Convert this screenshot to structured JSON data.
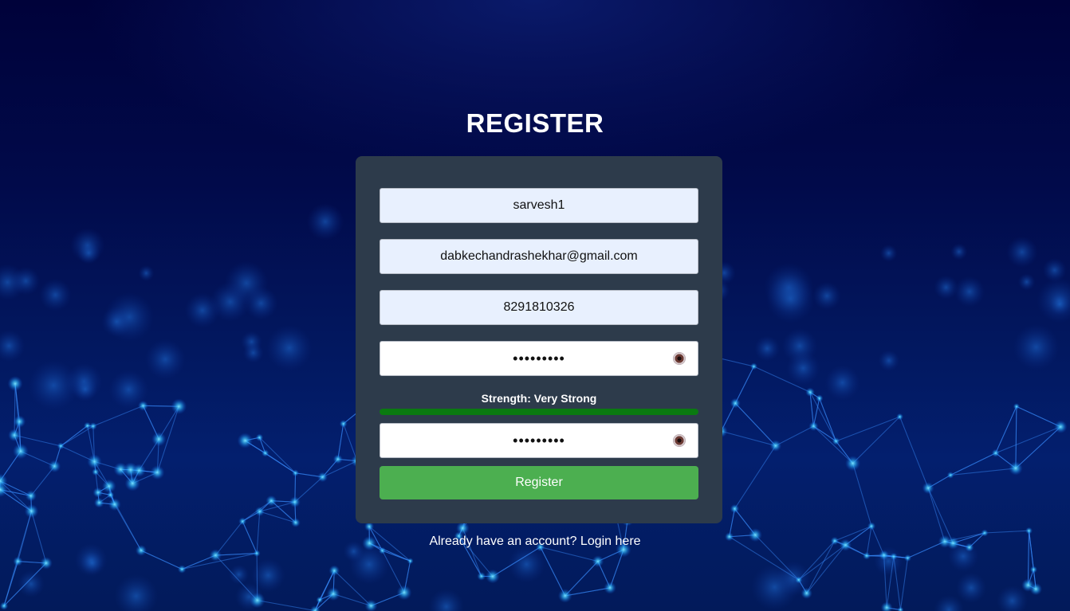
{
  "page": {
    "title": "REGISTER"
  },
  "form": {
    "username": {
      "value": "sarvesh1"
    },
    "email": {
      "value": "dabkechandrashekhar@gmail.com"
    },
    "phone": {
      "value": "8291810326"
    },
    "password": {
      "value": "sarvesh12",
      "toggle_icon": "eye-icon"
    },
    "strength": {
      "label": "Strength: Very Strong",
      "level": 1.0,
      "color": "#0a7a10"
    },
    "confirm_password": {
      "value": "sarvesh12",
      "toggle_icon": "eye-icon"
    },
    "submit_label": "Register"
  },
  "footer": {
    "prompt": "Already have an account?",
    "link_text": "Login here"
  },
  "colors": {
    "card": "#2d3b4b",
    "button": "#4caf50",
    "autofill_field": "#e8f0fe"
  }
}
